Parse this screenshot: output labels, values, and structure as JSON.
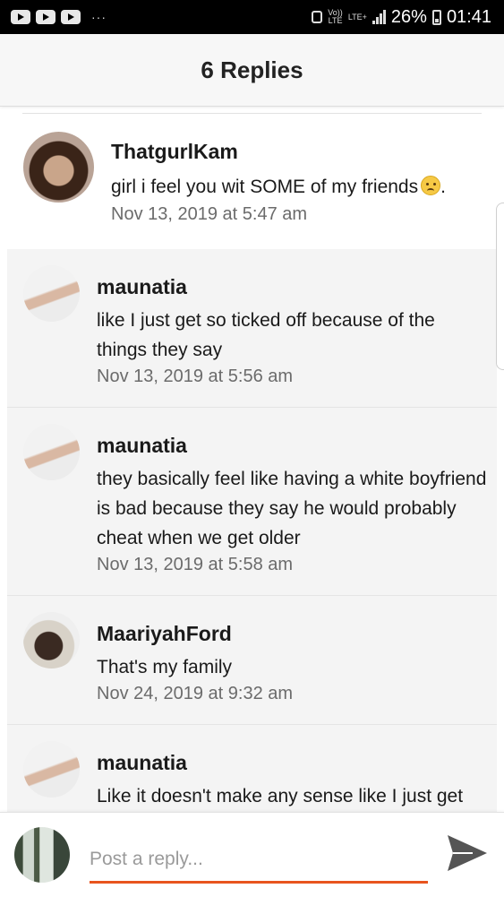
{
  "status_bar": {
    "network_top": "Vo))",
    "network_bottom": "LTE",
    "lte_plus": "LTE+",
    "battery": "26%",
    "time": "01:41",
    "dots": "···"
  },
  "header": {
    "title": "6 Replies"
  },
  "comments": [
    {
      "author": "ThatgurlKam",
      "body": "girl i feel you wit SOME of my friends",
      "trailing": ".",
      "date": "Nov 13, 2019 at 5:47 am"
    },
    {
      "author": "maunatia",
      "body": "like I just get so ticked off because of the things they say",
      "date": "Nov 13, 2019 at 5:56 am"
    },
    {
      "author": "maunatia",
      "body": "they basically feel like having a white boyfriend is bad because they say he would probably cheat when we get older",
      "date": "Nov 13, 2019 at 5:58 am"
    },
    {
      "author": "MaariyahFord",
      "body": "That's my family",
      "date": "Nov 24, 2019 at 9:32 am"
    },
    {
      "author": "maunatia",
      "body": "Like it doesn't make any sense like I just get"
    }
  ],
  "reply_bar": {
    "placeholder": "Post a reply..."
  },
  "colors": {
    "accent": "#e8541e",
    "header_bg": "#f7f7f7",
    "reply_bg": "#f4f4f4"
  },
  "icons": [
    "youtube-icon",
    "alarm-icon",
    "signal-icon",
    "battery-icon",
    "frown-emoji-icon",
    "send-icon"
  ]
}
